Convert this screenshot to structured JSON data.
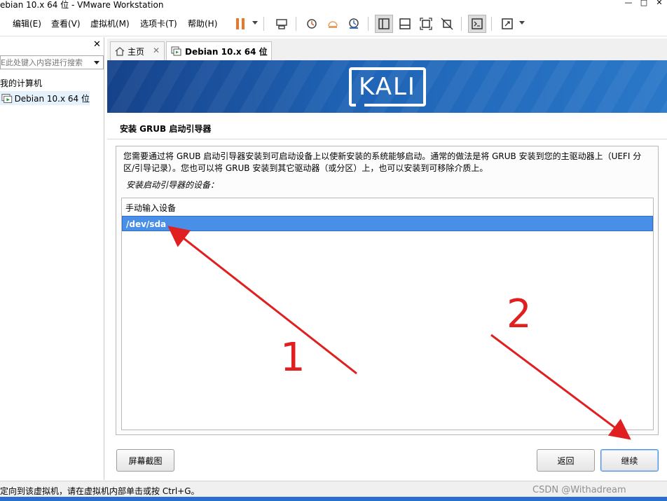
{
  "window": {
    "title": "ebian 10.x 64 位 - VMware Workstation",
    "controls": [
      "—",
      "□",
      "✕"
    ]
  },
  "menu": [
    "编辑(E)",
    "查看(V)",
    "虚拟机(M)",
    "选项卡(T)",
    "帮助(H)"
  ],
  "library": {
    "close": "✕",
    "search_placeholder": "E此处键入内容进行搜索",
    "root_label": "我的计算机",
    "vm_label": "Debian 10.x 64 位"
  },
  "tabs": [
    {
      "label": "主页",
      "close": "✕"
    },
    {
      "label": "Debian 10.x 64 位",
      "close": "✕"
    }
  ],
  "installer": {
    "logo_text": "KALI",
    "heading": "安装 GRUB 启动引导器",
    "description_line1": "您需要通过将 GRUB 启动引导器安装到可启动设备上以使新安装的系统能够启动。通常的做法是将 GRUB 安装到您的主驱动器上（UEFI 分",
    "description_line2": "区/引导记录）。您也可以将 GRUB 安装到其它驱动器（或分区）上，也可以安装到可移除介质上。",
    "question": "安装启动引导器的设备：",
    "devices": [
      "手动输入设备",
      "/dev/sda"
    ],
    "selected_index": 1,
    "buttons": {
      "screenshot": "屏幕截图",
      "back": "返回",
      "continue": "继续"
    }
  },
  "statusbar": {
    "text": "定向到该虚拟机，请在虚拟机内部单击或按 Ctrl+G。",
    "watermark": "CSDN @Withadream"
  },
  "annotations": {
    "labels": [
      "1",
      "2"
    ],
    "color": "#e02020"
  },
  "colors": {
    "accent": "#4a8fe7",
    "banner": "#1f64b6",
    "annotation": "#e02020"
  }
}
